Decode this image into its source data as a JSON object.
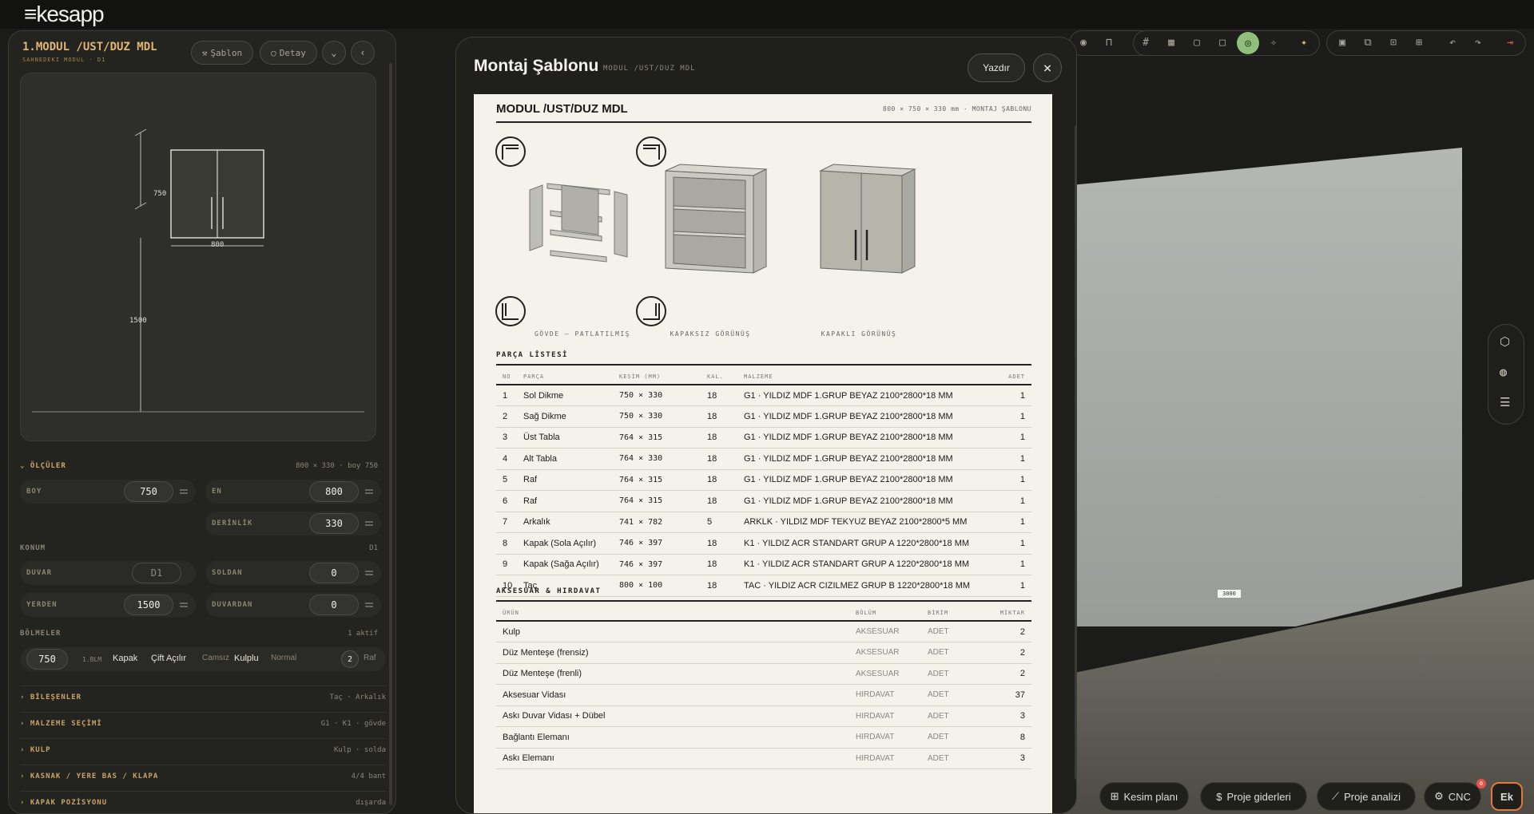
{
  "app": {
    "logo": "kesapp",
    "logo_mark": "≡"
  },
  "left_panel": {
    "title": "1.MODUL /UST/DUZ MDL",
    "subtitle": "SAHNEDEKI MODUL · D1",
    "sablon_label": "Şablon",
    "detay_label": "Detay",
    "preview": {
      "height": "750",
      "width": "800",
      "elevation": "1500"
    },
    "olculer": {
      "label": "ÖLÇÜLER",
      "summary": "800 × 330 · boy 750",
      "boy_label": "BOY",
      "boy": "750",
      "en_label": "EN",
      "en": "800",
      "derinlik_label": "DERİNLİK",
      "derinlik": "330"
    },
    "konum": {
      "label": "KONUM",
      "value": "D1",
      "duvar_label": "DUVAR",
      "duvar": "D1",
      "soldan_label": "SOLDAN",
      "soldan": "0",
      "yerden_label": "YERDEN",
      "yerden": "1500",
      "duvardan_label": "DUVARDAN",
      "duvardan": "0"
    },
    "bolmeler": {
      "label": "BÖLMELER",
      "status": "1 aktif",
      "size": "750",
      "unit": "1.BLM",
      "kapak": "Kapak",
      "cift": "Çift Açılır",
      "camsiz": "Camsız",
      "kulplu": "Kulplu",
      "normal": "Normal",
      "raf_count": "2",
      "raf": "Raf"
    },
    "accordions": [
      {
        "label": "BİLEŞENLER",
        "value": "Taç · Arkalık"
      },
      {
        "label": "MALZEME SEÇİMİ",
        "value": "G1 · K1 · gövde"
      },
      {
        "label": "KULP",
        "value": "Kulp · solda"
      },
      {
        "label": "KASNAK / YERE BAS / KLAPA",
        "value": "4/4 bant"
      },
      {
        "label": "KAPAK POZİSYONU",
        "value": "dışarda"
      }
    ]
  },
  "modal": {
    "title": "Montaj Şablonu",
    "subtitle": "MODUL /UST/DUZ MDL",
    "print_label": "Yazdır",
    "sheet": {
      "title": "MODUL /UST/DUZ MDL",
      "dims": "800 × 750 × 330 mm · MONTAJ ŞABLONU",
      "captions": [
        "GÖVDE — PATLATILMIŞ",
        "KAPAKSIZ GÖRÜNÜŞ",
        "KAPAKLI GÖRÜNÜŞ"
      ],
      "parts_heading": "PARÇA LİSTESİ",
      "parts_headers": [
        "NO",
        "PARÇA",
        "KESİM (MM)",
        "KAL.",
        "MALZEME",
        "ADET"
      ],
      "parts": [
        [
          "1",
          "Sol Dikme",
          "750 × 330",
          "18",
          "G1 · YILDIZ MDF 1.GRUP BEYAZ 2100*2800*18 MM",
          "1"
        ],
        [
          "2",
          "Sağ Dikme",
          "750 × 330",
          "18",
          "G1 · YILDIZ MDF 1.GRUP BEYAZ 2100*2800*18 MM",
          "1"
        ],
        [
          "3",
          "Üst Tabla",
          "764 × 315",
          "18",
          "G1 · YILDIZ MDF 1.GRUP BEYAZ 2100*2800*18 MM",
          "1"
        ],
        [
          "4",
          "Alt Tabla",
          "764 × 330",
          "18",
          "G1 · YILDIZ MDF 1.GRUP BEYAZ 2100*2800*18 MM",
          "1"
        ],
        [
          "5",
          "Raf",
          "764 × 315",
          "18",
          "G1 · YILDIZ MDF 1.GRUP BEYAZ 2100*2800*18 MM",
          "1"
        ],
        [
          "6",
          "Raf",
          "764 × 315",
          "18",
          "G1 · YILDIZ MDF 1.GRUP BEYAZ 2100*2800*18 MM",
          "1"
        ],
        [
          "7",
          "Arkalık",
          "741 × 782",
          "5",
          "ARKLK · YILDIZ MDF TEKYUZ BEYAZ 2100*2800*5 MM",
          "1"
        ],
        [
          "8",
          "Kapak (Sola Açılır)",
          "746 × 397",
          "18",
          "K1 · YILDIZ ACR STANDART GRUP A 1220*2800*18 MM",
          "1"
        ],
        [
          "9",
          "Kapak (Sağa Açılır)",
          "746 × 397",
          "18",
          "K1 · YILDIZ ACR STANDART GRUP A 1220*2800*18 MM",
          "1"
        ],
        [
          "10",
          "Taç",
          "800 × 100",
          "18",
          "TAC · YILDIZ ACR CIZILMEZ GRUP B 1220*2800*18 MM",
          "1"
        ]
      ],
      "acc_heading": "AKSESUAR & HIRDAVAT",
      "acc_headers": [
        "ÜRÜN",
        "BÖLÜM",
        "BİRİM",
        "MİKTAR"
      ],
      "accessories": [
        [
          "Kulp",
          "AKSESUAR",
          "ADET",
          "2"
        ],
        [
          "Düz Menteşe (frensiz)",
          "AKSESUAR",
          "ADET",
          "2"
        ],
        [
          "Düz Menteşe (frenli)",
          "AKSESUAR",
          "ADET",
          "2"
        ],
        [
          "Aksesuar Vidası",
          "HIRDAVAT",
          "ADET",
          "37"
        ],
        [
          "Askı Duvar Vidası + Dübel",
          "HIRDAVAT",
          "ADET",
          "3"
        ],
        [
          "Bağlantı Elemanı",
          "HIRDAVAT",
          "ADET",
          "8"
        ],
        [
          "Askı Elemanı",
          "HIRDAVAT",
          "ADET",
          "3"
        ]
      ]
    }
  },
  "scene": {
    "dim_label": "3000"
  },
  "bottom_bar": {
    "kesim": "Kesim planı",
    "giderler": "Proje giderleri",
    "analiz": "Proje analizi",
    "cnc": "CNC",
    "cnc_badge": "0",
    "brand": "Ek"
  },
  "colors": {
    "accent": "#e0b673",
    "active_tool": "#8fbf7a",
    "danger": "#e0584a"
  }
}
